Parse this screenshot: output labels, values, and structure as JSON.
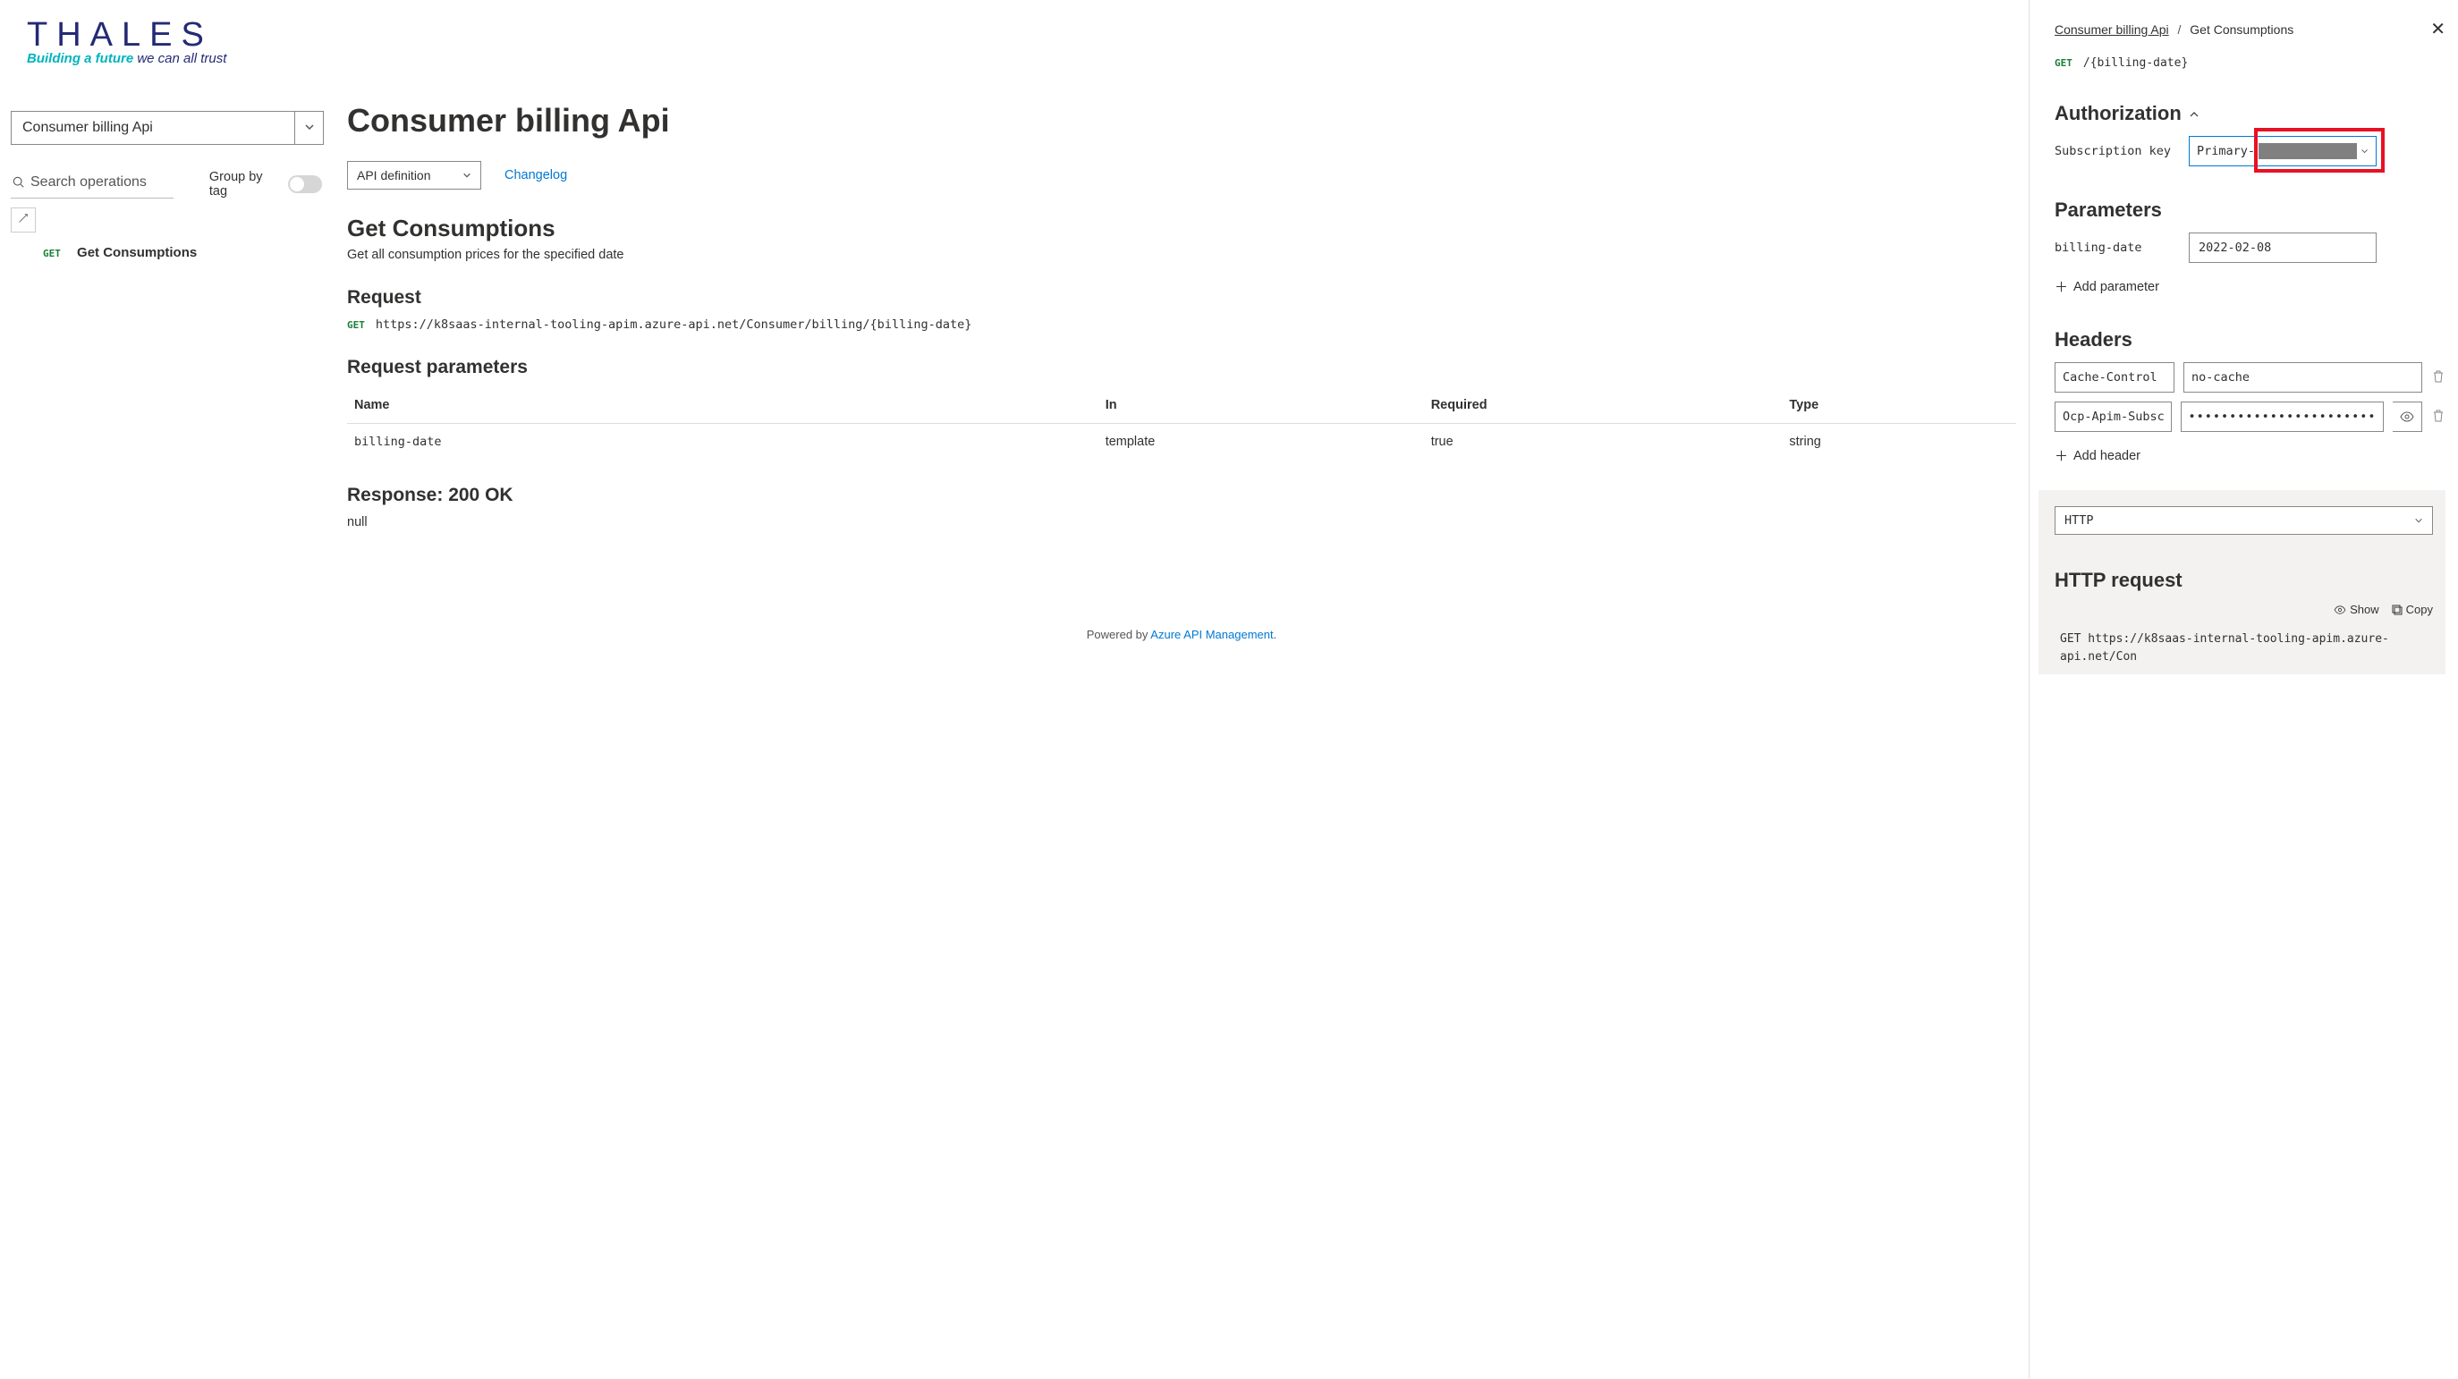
{
  "logo": {
    "name": "THALES",
    "tagline_teal": "Building a future ",
    "tagline_navy": "we can all trust"
  },
  "sidebar": {
    "api_select": "Consumer billing Api",
    "search_placeholder": "Search operations",
    "group_by_tag": "Group by tag",
    "operations": [
      {
        "method": "GET",
        "name": "Get Consumptions"
      }
    ]
  },
  "main": {
    "title": "Consumer billing Api",
    "api_def_label": "API definition",
    "changelog": "Changelog",
    "operation_title": "Get Consumptions",
    "operation_desc": "Get all consumption prices for the specified date",
    "request_heading": "Request",
    "request_method": "GET",
    "request_url": "https://k8saas-internal-tooling-apim.azure-api.net/Consumer/billing/{billing-date}",
    "req_params_heading": "Request parameters",
    "params_table": {
      "headers": {
        "name": "Name",
        "in": "In",
        "required": "Required",
        "type": "Type"
      },
      "rows": [
        {
          "name": "billing-date",
          "in": "template",
          "required": "true",
          "type": "string"
        }
      ]
    },
    "response_heading": "Response: 200 OK",
    "response_body": "null",
    "powered_prefix": "Powered by ",
    "powered_link": "Azure API Management"
  },
  "panel": {
    "crumb_root": "Consumer billing Api",
    "crumb_leaf": "Get Consumptions",
    "path_method": "GET",
    "path": "/{billing-date}",
    "auth_heading": "Authorization",
    "sub_key_label": "Subscription key",
    "sub_key_select": "Primary-",
    "params_heading": "Parameters",
    "params": [
      {
        "name": "billing-date",
        "value": "2022-02-08"
      }
    ],
    "add_parameter": "Add parameter",
    "headers_heading": "Headers",
    "headers": [
      {
        "name": "Cache-Control",
        "value": "no-cache",
        "secret": false
      },
      {
        "name": "Ocp-Apim-Subsc",
        "value": "•••••••••••••••••••••••",
        "secret": true
      }
    ],
    "add_header": "Add header",
    "lang_select": "HTTP",
    "http_req_heading": "HTTP request",
    "show_label": "Show",
    "copy_label": "Copy",
    "http_request_code": "GET https://k8saas-internal-tooling-apim.azure-api.net/Con"
  }
}
